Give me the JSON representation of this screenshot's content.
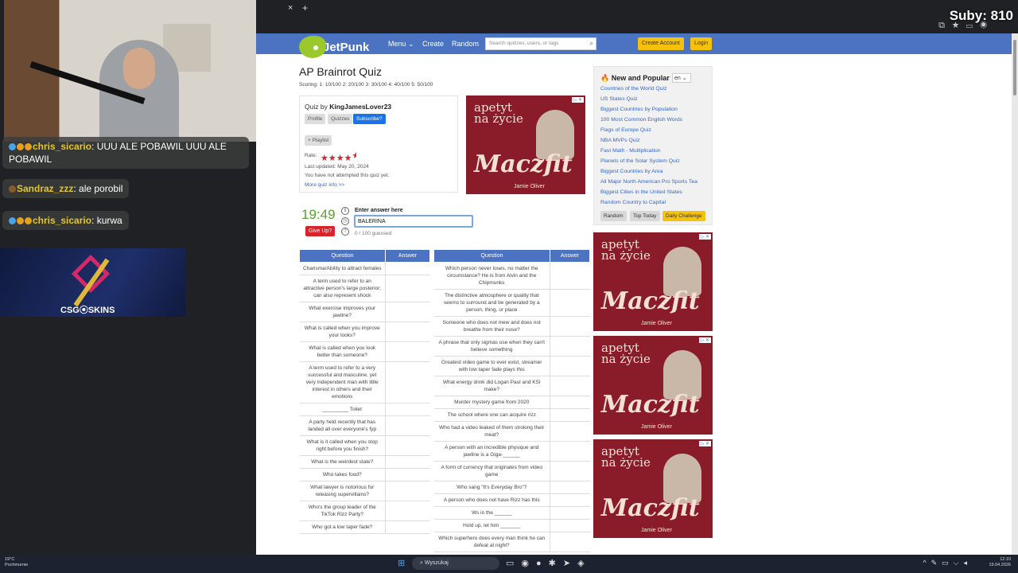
{
  "overlay": {
    "subs": "Suby: 810",
    "chat": [
      {
        "user": "chris_sicario",
        "message": ": UUU ALE POBAWIL UUU ALE POBAWIL",
        "color": "#e6c52a"
      },
      {
        "user": "Sandraz_zzz",
        "message": ": ale porobil",
        "color": "#e6c52a"
      },
      {
        "user": "chris_sicario",
        "message": ": kurwa",
        "color": "#e6c52a"
      }
    ],
    "sponsor": "CSG⦿SKINS"
  },
  "browser": {
    "new_tab": "+",
    "tab_close": "×"
  },
  "header": {
    "logo": "JetPunk",
    "menu": "Menu",
    "create": "Create",
    "random": "Random",
    "search_placeholder": "Search quizzes, users, or tags",
    "create_account": "Create Account",
    "login": "Login"
  },
  "quiz": {
    "title": "AP Brainrot Quiz",
    "scoring": "Scoring: 1: 10/100 2: 20/100 3: 30/100 4: 40/100 5: 50/100",
    "quiz_by_label": "Quiz by",
    "author": "KingJamesLover23",
    "profile": "Profile",
    "quizzes": "Quizzes",
    "subscribe": "Subscribe?",
    "playlist": "+ Playlist",
    "rate_label": "Rate:",
    "rating": 4.5,
    "updated": "Last updated: May 20, 2024",
    "not_attempted": "You have not attempted this quiz yet.",
    "more_info": "More quiz info >>",
    "timer": "19:49",
    "give_up": "Give Up?",
    "answer_label": "Enter answer here",
    "answer_value": "BALERINA",
    "guessed": "0 / 100 guessed",
    "col_question": "Question",
    "col_answer": "Answer",
    "left_questions": [
      "Charisma/Ability to attract females",
      "A term used to refer to an attractive person's large posterior; can also represent shock",
      "What exercise improves your jawline?",
      "What is called when you improve your looks?",
      "What is called when you look better than someone?",
      "A term used to refer to a very successful and masculine, yet very independent man with little interest in others and their emotions",
      "_________ Toilet",
      "A party held recently that has landed all over everyone's fyp",
      "What is it called when you stop right before you finish?",
      "What is the weirdest state?",
      "Who takes food?",
      "What lawyer is notorious for releasing supervillains?",
      "Who's the group leader of the TikTok Rizz Party?",
      "Who got a low taper fade?"
    ],
    "right_questions": [
      "Which person never loses, no matter the circumstance? He is from Alvin and the Chipmunks",
      "The distinctive atmosphere or quality that seems to surround and be generated by a person, thing, or place",
      "Someone who does not mew and does not breathe from their nose?",
      "A phrase that only sigmas use when they can't believe something",
      "Greatest video game to ever exist, streamer with low taper fade plays this",
      "What energy drink did Logan Paul and KSI make?",
      "Murder mystery game from 2020",
      "The school where one can acquire rizz",
      "Who had a video leaked of them stroking their meat?",
      "A person with an incredible physique and jawline is a Giga-______",
      "A form of currency that originates from video game",
      "Who sang \"It's Everyday Bro\"?",
      "A person who does not have Rizz has this",
      "Ws in the ______",
      "Hold up, let him _______",
      "Which superhero does every man think he can defeat at night?"
    ]
  },
  "sidebar": {
    "title": "New and Popular",
    "lang": "en",
    "links": [
      "Countries of the World Quiz",
      "US States Quiz",
      "Biggest Countries by Population",
      "100 Most Common English Words",
      "Flags of Europe Quiz",
      "NBA MVPs Quiz",
      "Fast Math - Multiplication",
      "Planets of the Solar System Quiz",
      "Biggest Countries by Area",
      "All Major North American Pro Sports Tea",
      "Biggest Cities in the United States",
      "Random Country to Capital"
    ],
    "random": "Random",
    "top_today": "Top Today",
    "daily": "Daily Challenge"
  },
  "ads": {
    "line1": "apetyt",
    "line2": "na życie",
    "brand": "Maczfit",
    "sub": "Jamie Oliver",
    "x": "▷ ✕"
  },
  "taskbar": {
    "temp": "19°C",
    "weather": "Pochmurnie",
    "search": "Wyszukaj",
    "time": "12:10",
    "date": "19.04.2026"
  }
}
